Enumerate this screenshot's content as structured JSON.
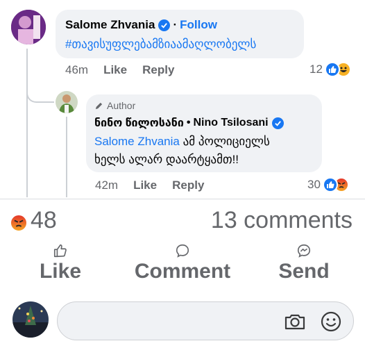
{
  "comment": {
    "author": "Salome Zhvania",
    "follow_label": "Follow",
    "separator": "·",
    "text": "#თავისუფლებამზიაამაღლობელს",
    "time": "46m",
    "like_label": "Like",
    "reply_label": "Reply",
    "reaction_count": "12",
    "reactions": [
      "like",
      "haha"
    ]
  },
  "reply": {
    "author_badge": "Author",
    "author_name_ka": "ნინო წილოსანი",
    "separator": "•",
    "author_name": "Nino Tsilosani",
    "mention": "Salome Zhvania",
    "text_line1": "ამ პოლიციელს",
    "text_line2": "ხელს ალარ დაარტყამთ!!",
    "time": "42m",
    "like_label": "Like",
    "reply_label": "Reply",
    "reaction_count": "30",
    "reactions": [
      "like",
      "angry"
    ]
  },
  "summary": {
    "reaction_count": "48",
    "comments_label": "13 comments",
    "reaction": "angry"
  },
  "actions": {
    "like_label": "Like",
    "comment_label": "Comment",
    "send_label": "Send"
  },
  "composer": {
    "placeholder": "",
    "icons": [
      "camera-icon",
      "emoji-icon"
    ]
  },
  "colors": {
    "accent": "#1877f2",
    "muted": "#65676b",
    "bubble": "#f0f2f5",
    "angry": "#e9710f"
  }
}
